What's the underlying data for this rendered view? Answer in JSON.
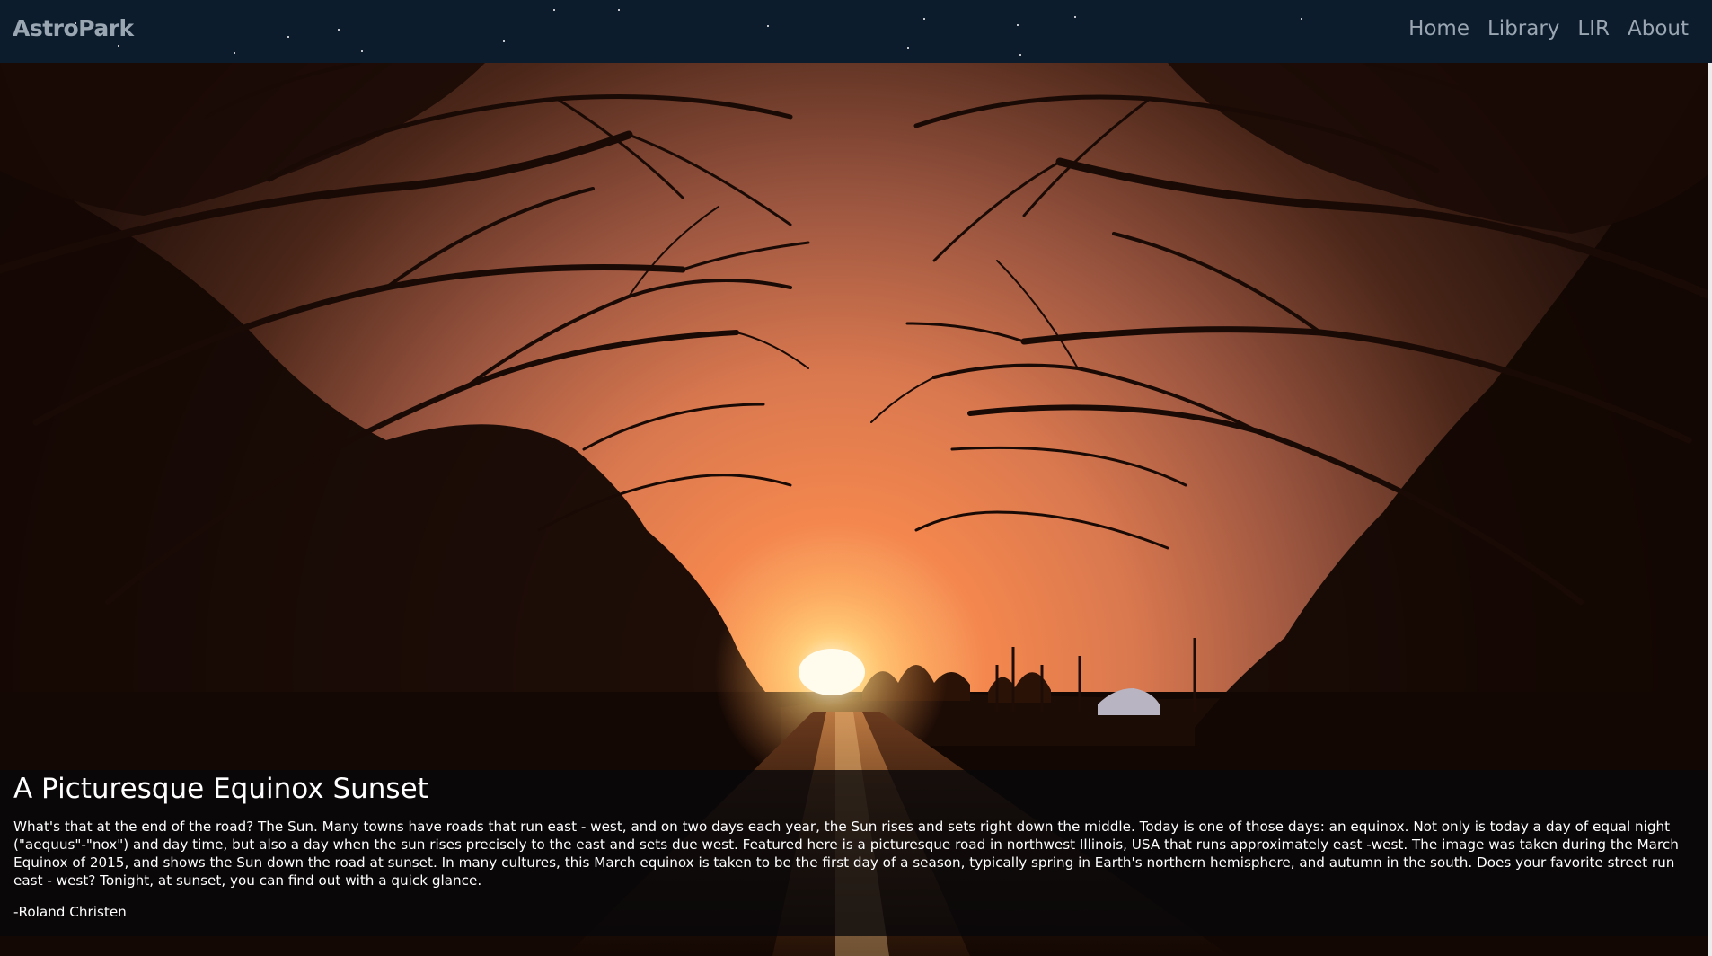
{
  "navbar": {
    "brand": "AstroPark",
    "links": [
      "Home",
      "Library",
      "LIR",
      "About"
    ]
  },
  "hero": {
    "image": "sunset-road-photo",
    "title": "A Picturesque Equinox Sunset",
    "description": "What's that at the end of the road? The Sun. Many towns have roads that run east - west, and on two days each year, the Sun rises and sets right down the middle. Today is one of those days: an equinox. Not only is today a day of equal night (\"aequus\"-\"nox\") and day time, but also a day when the sun rises precisely to the east and sets due west. Featured here is a picturesque road in northwest Illinois, USA that runs approximately east -west. The image was taken during the March Equinox of 2015, and shows the Sun down the road at sunset. In many cultures, this March equinox is taken to be the first day of a season, typically spring in Earth's northern hemisphere, and autumn in the south. Does your favorite street run east - west? Tonight, at sunset, you can find out with a quick glance.",
    "credit": "-Roland Christen"
  },
  "colors": {
    "navbar_bg": "#0c1c2c",
    "nav_text": "#9aa6b2",
    "sky_glow": "#f08a4c",
    "sun": "#fffbe6"
  }
}
